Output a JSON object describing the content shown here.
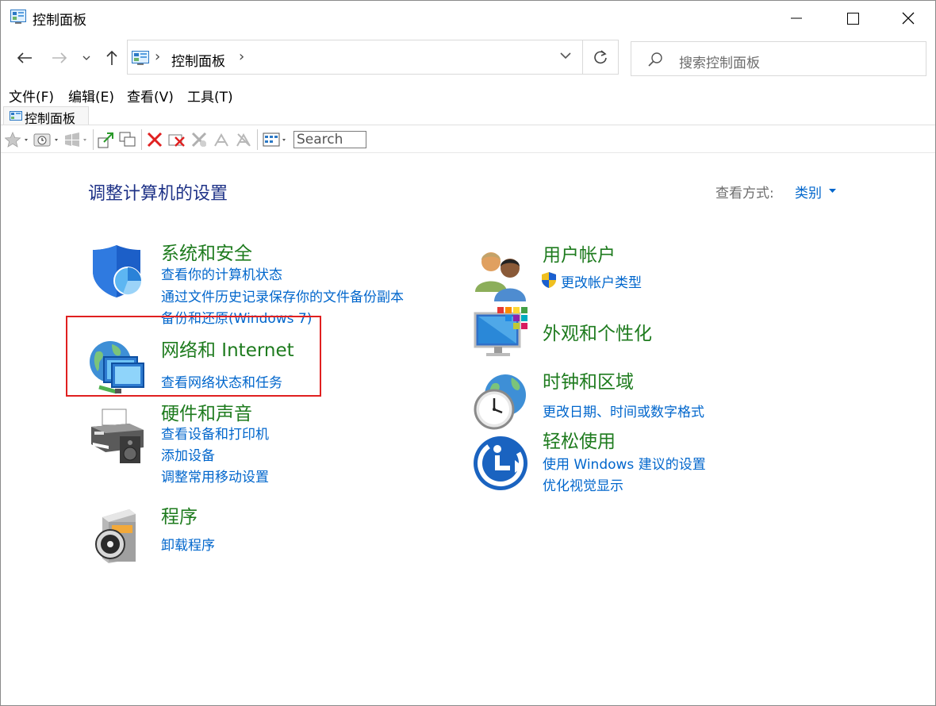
{
  "window": {
    "title": "控制面板"
  },
  "nav": {
    "address_text": "控制面板",
    "address_sep": "›",
    "search_placeholder": "搜索控制面板"
  },
  "menu": {
    "items": [
      "文件(F)",
      "编辑(E)",
      "查看(V)",
      "工具(T)"
    ]
  },
  "tab": {
    "label": "控制面板"
  },
  "toolbar": {
    "search_label": "Search"
  },
  "main": {
    "heading": "调整计算机的设置",
    "view_label": "查看方式:",
    "view_value": "类别",
    "categories": [
      {
        "title": "系统和安全",
        "links": [
          "查看你的计算机状态",
          "通过文件历史记录保存你的文件备份副本",
          "备份和还原(Windows 7)"
        ]
      },
      {
        "title": "网络和 Internet",
        "links": [
          "查看网络状态和任务"
        ]
      },
      {
        "title": "硬件和声音",
        "links": [
          "查看设备和打印机",
          "添加设备",
          "调整常用移动设置"
        ]
      },
      {
        "title": "程序",
        "links": [
          "卸载程序"
        ]
      },
      {
        "title": "用户帐户",
        "links": [
          "更改帐户类型"
        ]
      },
      {
        "title": "外观和个性化",
        "links": []
      },
      {
        "title": "时钟和区域",
        "links": [
          "更改日期、时间或数字格式"
        ]
      },
      {
        "title": "轻松使用",
        "links": [
          "使用 Windows 建议的设置",
          "优化视觉显示"
        ]
      }
    ]
  },
  "colors": {
    "heading": "#1e3287",
    "category_title": "#1e7b1e",
    "link": "#0066cc",
    "highlight_border": "#e02020"
  },
  "icons": [
    "control-panel-icon",
    "back-icon",
    "forward-icon",
    "recent-dropdown-icon",
    "up-icon",
    "refresh-icon",
    "search-icon",
    "minimize-icon",
    "maximize-icon",
    "close-icon",
    "shield-icon",
    "network-globe-icon",
    "printer-icon",
    "programs-disc-icon",
    "users-icon",
    "uac-shield-icon",
    "appearance-monitor-icon",
    "clock-globe-icon",
    "ease-of-access-icon"
  ]
}
